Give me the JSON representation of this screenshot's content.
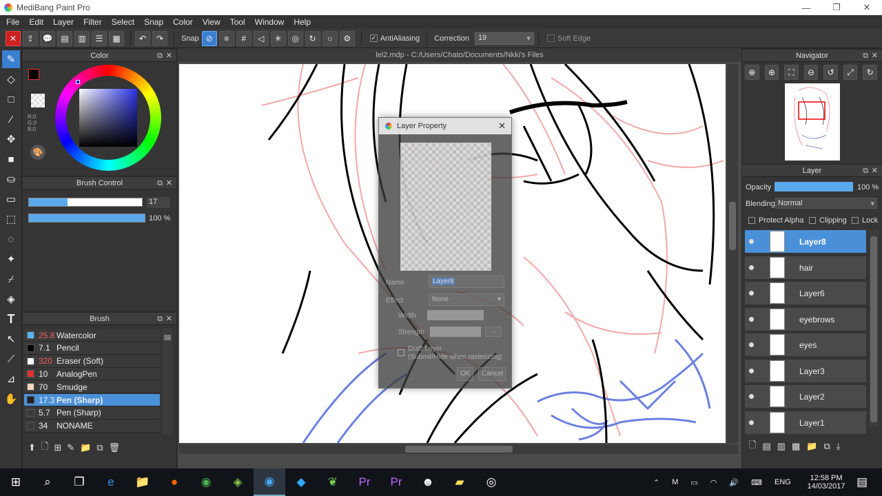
{
  "window": {
    "title": "MediBang Paint Pro",
    "minimize": "—",
    "restore": "❐",
    "close": "✕"
  },
  "menu": [
    "File",
    "Edit",
    "Layer",
    "Filter",
    "Select",
    "Snap",
    "Color",
    "View",
    "Tool",
    "Window",
    "Help"
  ],
  "toolbar": {
    "snap_label": "Snap",
    "antialias_label": "AntiAliasing",
    "correction_label": "Correction",
    "correction_value": "19",
    "soft_edge_label": "Soft Edge"
  },
  "color_panel": {
    "title": "Color",
    "rgb": {
      "r": "R:0",
      "g": "G:0",
      "b": "B:0"
    },
    "fg_color": "#000000"
  },
  "brush_control": {
    "title": "Brush Control",
    "size_value": "17",
    "opacity_value": "100 %",
    "size_fraction": 0.34,
    "opacity_fraction": 1.0
  },
  "brush_panel": {
    "title": "Brush",
    "items": [
      {
        "size": "25.8",
        "name": "Watercolor",
        "color": "#5ab4f0",
        "red": true
      },
      {
        "size": "7.1",
        "name": "Pencil",
        "color": "#000000",
        "red": false
      },
      {
        "size": "320",
        "name": "Eraser (Soft)",
        "color": "#ffffff",
        "red": true
      },
      {
        "size": "10",
        "name": "AnalogPen",
        "color": "#e03030",
        "red": false
      },
      {
        "size": "70",
        "name": "Smudge",
        "color": "#f5d5c0",
        "red": false
      },
      {
        "size": "17.3",
        "name": "Pen (Sharp)",
        "color": "#222222",
        "red": false,
        "selected": true
      },
      {
        "size": "5.7",
        "name": "Pen (Sharp)",
        "color": "#3a3a3a",
        "red": false
      },
      {
        "size": "34",
        "name": "NONAME",
        "color": "#3a3a3a",
        "red": false
      }
    ]
  },
  "document": {
    "tab": "lel2.mdp - C:/Users/Chato/Documents/Nkki's Files"
  },
  "dialog": {
    "title": "Layer Property",
    "name_label": "Name",
    "name_value": "Layer8",
    "effect_label": "Effect",
    "effect_value": "None",
    "width_label": "Width",
    "strength_label": "Strength",
    "draft_label": "Draft Layer",
    "draft_sub": "(Submit/Hide when rasterizing)",
    "ok": "OK",
    "cancel": "Cancel"
  },
  "navigator": {
    "title": "Navigator"
  },
  "layer_panel": {
    "title": "Layer",
    "opacity_label": "Opacity",
    "opacity_value": "100 %",
    "opacity_fraction": 1.0,
    "blending_label": "Blending",
    "blending_value": "Normal",
    "protect_alpha": "Protect Alpha",
    "clipping": "Clipping",
    "lock": "Lock",
    "layers": [
      {
        "name": "Layer8",
        "selected": true
      },
      {
        "name": "hair"
      },
      {
        "name": "Layer6"
      },
      {
        "name": "eyebrows"
      },
      {
        "name": "eyes"
      },
      {
        "name": "Layer3"
      },
      {
        "name": "Layer2"
      },
      {
        "name": "Layer1"
      }
    ]
  },
  "taskbar": {
    "lang": "ENG",
    "time": "12:58 PM",
    "date": "14/03/2017"
  }
}
